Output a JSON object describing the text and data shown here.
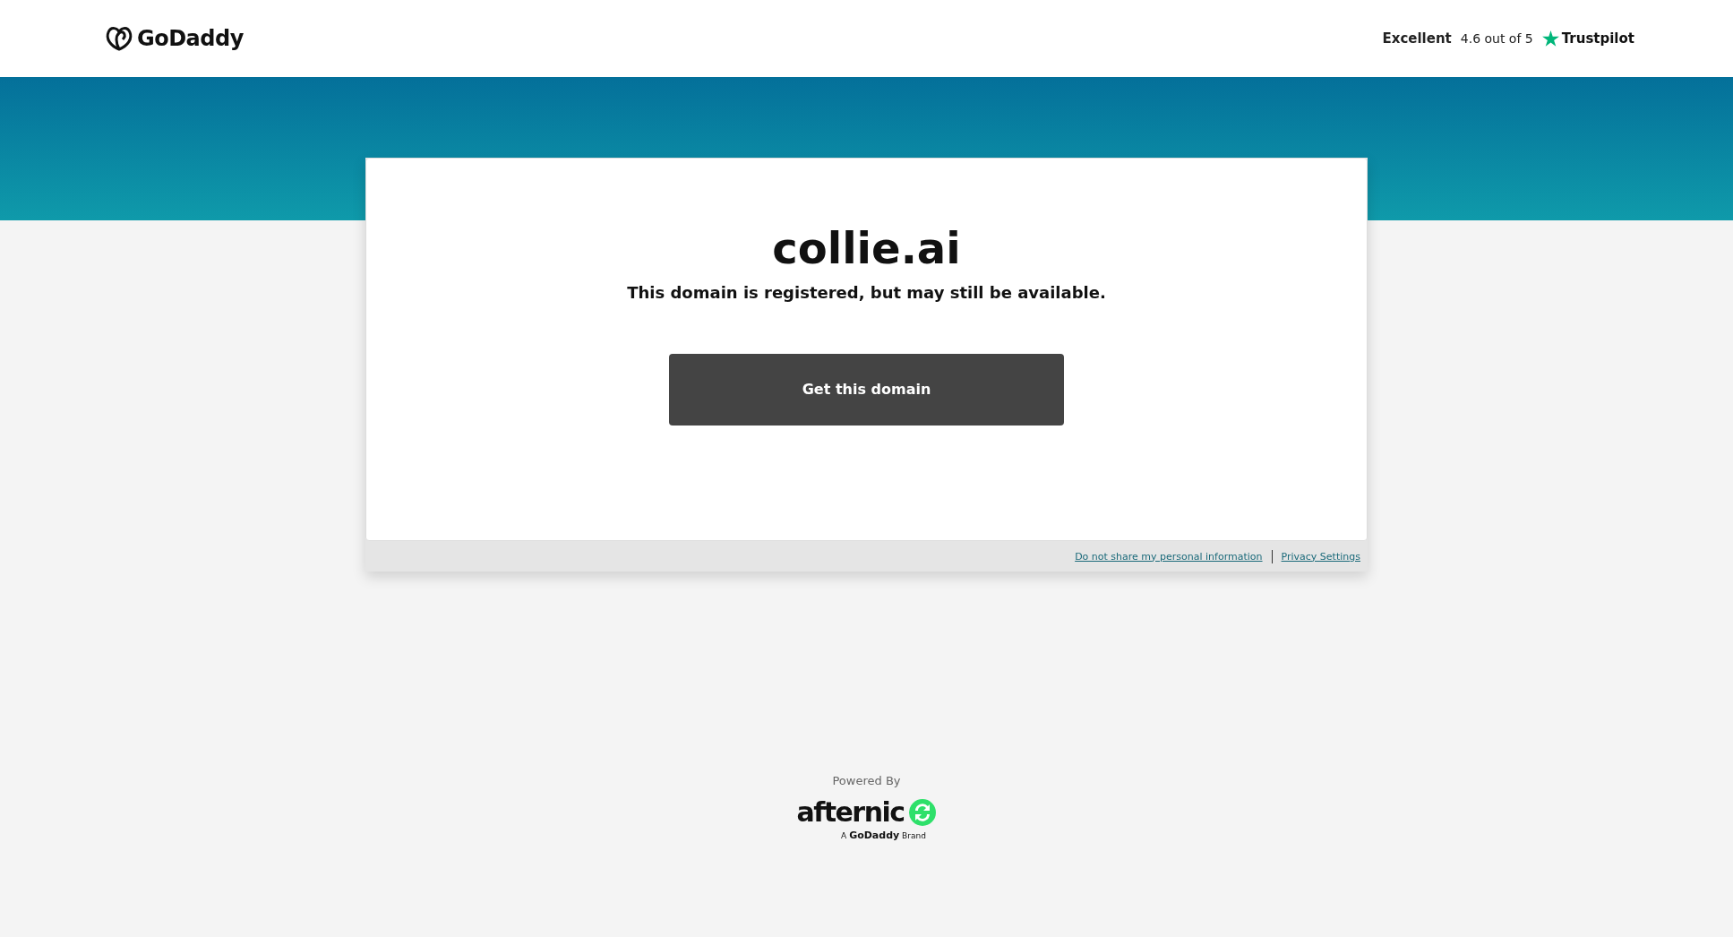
{
  "header": {
    "logo_text": "GoDaddy",
    "rating_label": "Excellent",
    "rating_score": "4.6 out of 5",
    "rating_brand": "Trustpilot"
  },
  "card": {
    "domain": "collie.ai",
    "message": "This domain is registered, but may still be available.",
    "button": "Get this domain"
  },
  "card_footer_links": [
    "Do not share my personal information",
    "Privacy Settings"
  ],
  "powered": {
    "label": "Powered By",
    "brand": "afternic",
    "tagline_prefix": "A",
    "tagline_brand": "GoDaddy",
    "tagline_suffix": "Brand"
  }
}
